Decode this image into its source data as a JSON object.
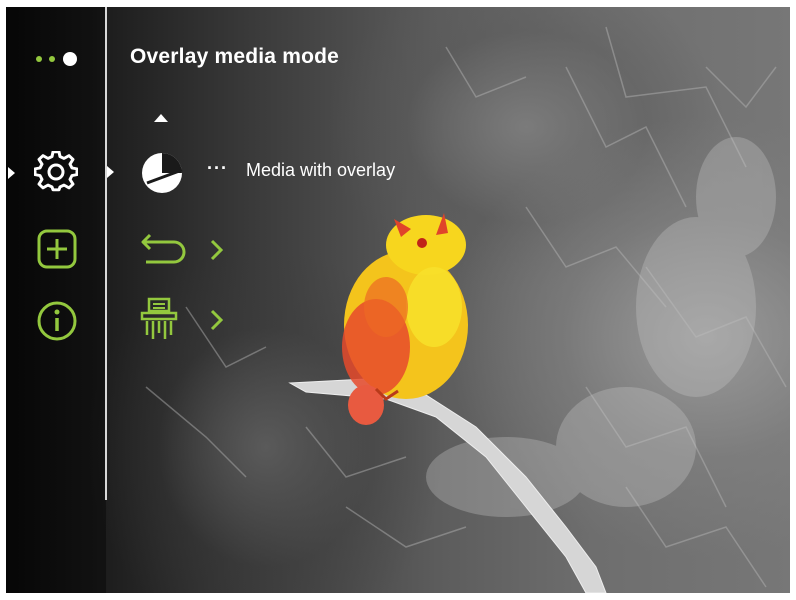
{
  "header": {
    "title": "Overlay media mode",
    "page_dots": [
      "inactive",
      "inactive",
      "active"
    ]
  },
  "sidebar": {
    "items": [
      {
        "icon": "gear-icon",
        "selected": true
      },
      {
        "icon": "plus-square-icon",
        "selected": false
      },
      {
        "icon": "info-icon",
        "selected": false
      }
    ]
  },
  "menu": {
    "options": [
      {
        "icon": "overlay-half-circle-icon",
        "label": "Media with overlay",
        "selected": true
      },
      {
        "icon": "undo-arrow-icon",
        "has_chevron": true
      },
      {
        "icon": "shredder-icon",
        "has_chevron": true
      }
    ]
  },
  "colors": {
    "accent": "#93c83e",
    "text": "#ffffff",
    "divider": "#d8d8d8"
  }
}
